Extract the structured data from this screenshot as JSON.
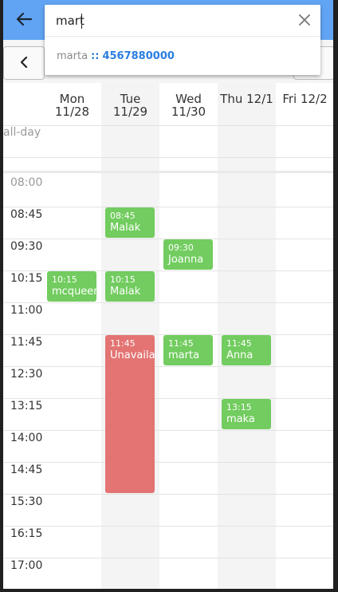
{
  "search": {
    "query": "mart",
    "suggestion": {
      "name": "marta",
      "separator": "::",
      "phone": "4567880000"
    }
  },
  "calendar": {
    "allday_label": "all-day",
    "days": [
      {
        "label": "Mon\n11/28"
      },
      {
        "label": "Tue\n11/29"
      },
      {
        "label": "Wed\n11/30"
      },
      {
        "label": "Thu 12/1"
      },
      {
        "label": "Fri 12/2"
      }
    ],
    "times": [
      "08:00",
      "08:45",
      "09:30",
      "10:15",
      "11:00",
      "11:45",
      "12:30",
      "13:15",
      "14:00",
      "14:45",
      "15:30",
      "16:15",
      "17:00"
    ],
    "events": [
      {
        "day": 1,
        "start": "08:45",
        "time": "08:45",
        "title": "Malak",
        "type": "booking"
      },
      {
        "day": 2,
        "start": "09:30",
        "time": "09:30",
        "title": "Joanna",
        "type": "booking"
      },
      {
        "day": 0,
        "start": "10:15",
        "time": "10:15",
        "title": "mcqueen",
        "type": "booking"
      },
      {
        "day": 1,
        "start": "10:15",
        "time": "10:15",
        "title": "Malak",
        "type": "booking"
      },
      {
        "day": 1,
        "start": "11:45",
        "time": "11:45",
        "title": "Unavailable",
        "type": "unavailable",
        "slots": 5
      },
      {
        "day": 2,
        "start": "11:45",
        "time": "11:45",
        "title": "marta",
        "type": "booking"
      },
      {
        "day": 3,
        "start": "11:45",
        "time": "11:45",
        "title": "Anna",
        "type": "booking"
      },
      {
        "day": 3,
        "start": "13:15",
        "time": "13:15",
        "title": "maka",
        "type": "booking"
      }
    ]
  },
  "colors": {
    "appbar": "#61a4f3",
    "booking": "#72cc5f",
    "unavailable": "#e37473",
    "link": "#2b7de0"
  }
}
